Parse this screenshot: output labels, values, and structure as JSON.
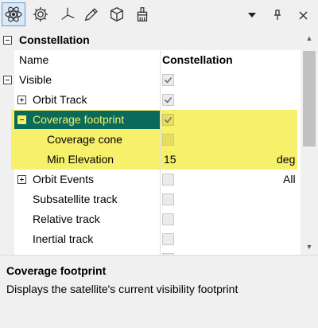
{
  "toolbar": {
    "icons": [
      "atom-icon",
      "gear-icon",
      "axes-icon",
      "pencil-icon",
      "cube-icon",
      "paintbrush-icon"
    ],
    "right_icons": [
      "dropdown-arrow-icon",
      "pin-icon",
      "close-icon"
    ]
  },
  "grid": {
    "category": "Constellation",
    "header": {
      "name": "Name",
      "value": "Constellation"
    },
    "rows": [
      {
        "label": "Visible",
        "checked": true
      },
      {
        "label": "Orbit Track",
        "checked": true
      },
      {
        "label": "Coverage footprint",
        "checked": true
      },
      {
        "label": "Coverage cone",
        "checked": false
      },
      {
        "label": "Min Elevation",
        "value": "15",
        "unit": "deg"
      },
      {
        "label": "Orbit Events",
        "value": "All"
      },
      {
        "label": "Subsatellite track",
        "checked": false
      },
      {
        "label": "Relative track",
        "checked": false
      },
      {
        "label": "Inertial track",
        "checked": false
      }
    ]
  },
  "description": {
    "title": "Coverage footprint",
    "text": "Displays the satellite's current visibility footprint"
  },
  "colors": {
    "highlight": "#f6f06a",
    "selected_row": "#0a6b5a",
    "toolbar_active": "#dbe9f7"
  }
}
